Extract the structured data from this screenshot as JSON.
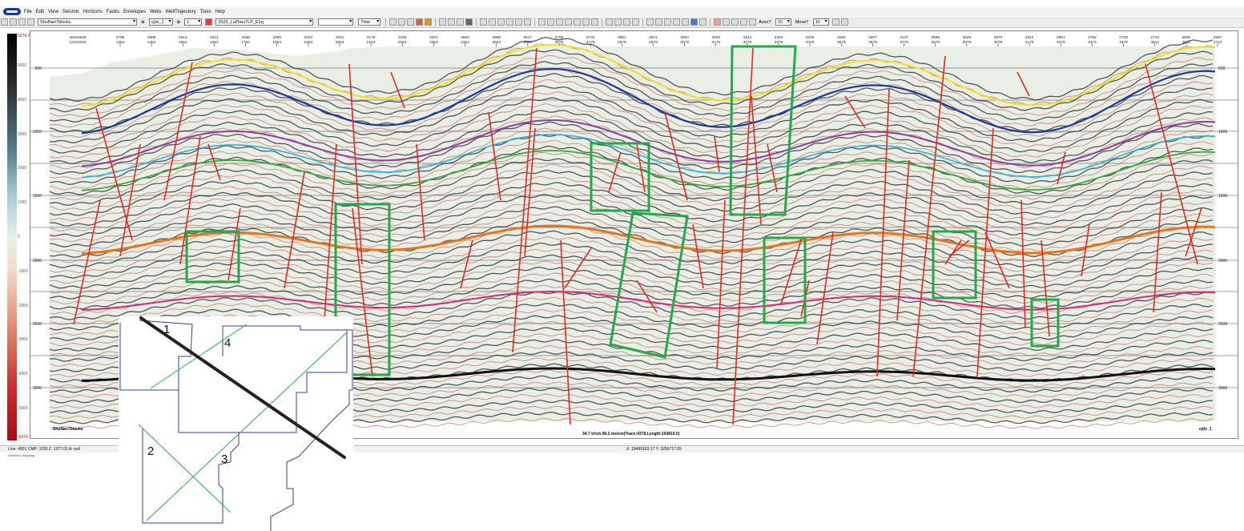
{
  "menu": [
    "File",
    "Edit",
    "View",
    "Seismic",
    "Horizons",
    "Faults",
    "Envelopes",
    "Wells",
    "WellTrajectory",
    "Tools",
    "Help"
  ],
  "toolbar": {
    "survey": "ShuNan7blocks",
    "line": "cjdx_1",
    "line_index": "1",
    "horizon": "2023_LuZhou7LP_E1q",
    "domain": "Time",
    "mode_value": "",
    "assoc_label": "AssoT",
    "assoc_value": "10",
    "move_label": "MoveT",
    "move_value": "10"
  },
  "colorbar": {
    "top_value": "6974.71",
    "bottom_value": "-6974.7",
    "labels": [
      "5000",
      "4000",
      "3000",
      "2000",
      "1000",
      "0",
      "-1000",
      "-2000",
      "-3000",
      "-4000",
      "-5000"
    ]
  },
  "axis": {
    "top_left_trace": "4845\n4830",
    "top_left_cmp": "1233\n1254",
    "ticks": [
      {
        "t": "4758",
        "c": "1354"
      },
      {
        "t": "4685",
        "c": "1454"
      },
      {
        "t": "4613",
        "c": "1554"
      },
      {
        "t": "4541",
        "c": "1654"
      },
      {
        "t": "4468",
        "c": "1754"
      },
      {
        "t": "4396",
        "c": "1854"
      },
      {
        "t": "4324",
        "c": "1954"
      },
      {
        "t": "4251",
        "c": "2054"
      },
      {
        "t": "4179",
        "c": "2154"
      },
      {
        "t": "4106",
        "c": "2254"
      },
      {
        "t": "4034",
        "c": "2354"
      },
      {
        "t": "3962",
        "c": "2454"
      },
      {
        "t": "3889",
        "c": "2554"
      },
      {
        "t": "3817",
        "c": "2654"
      },
      {
        "t": "3799",
        "c": "2679"
      },
      {
        "t": "3740",
        "c": "2779"
      },
      {
        "t": "3681",
        "c": "2879"
      },
      {
        "t": "3621",
        "c": "2979"
      },
      {
        "t": "3562",
        "c": "3079"
      },
      {
        "t": "3503",
        "c": "3179"
      },
      {
        "t": "3444",
        "c": "3279"
      },
      {
        "t": "3384",
        "c": "3379"
      },
      {
        "t": "3325",
        "c": "3479"
      },
      {
        "t": "3266",
        "c": "3579"
      },
      {
        "t": "3207",
        "c": "3679"
      },
      {
        "t": "3147",
        "c": "3779"
      },
      {
        "t": "3088",
        "c": "3879"
      },
      {
        "t": "3029",
        "c": "3979"
      },
      {
        "t": "2970",
        "c": "4079"
      },
      {
        "t": "2910",
        "c": "4179"
      },
      {
        "t": "2851",
        "c": "4279"
      },
      {
        "t": "2792",
        "c": "4379"
      },
      {
        "t": "2733",
        "c": "4479"
      },
      {
        "t": "2713",
        "c": "4512"
      },
      {
        "t": "2655",
        "c": "4612"
      },
      {
        "t": "2597",
        "c": "4712"
      }
    ],
    "time_labels": [
      "500",
      "1000",
      "1500",
      "2000",
      "2500",
      "3000"
    ]
  },
  "section": {
    "left_label": "ShuNan7blocks",
    "right_label": "cjdx_1",
    "scale_info": "34.7 tr/cm 96.2 ms/cm(Trace:4378,Length:103810.0)"
  },
  "status": {
    "left": "Line: 4901 CMP: 1155 Z: 1377.01 A: null",
    "right": "X: 18499163.17 Y: 3256717.05",
    "sub": "Directivo: ding/dog"
  },
  "inset_map": {
    "labels": [
      "1",
      "2",
      "3",
      "4"
    ]
  },
  "colors": {
    "fault": "#e8281e",
    "box": "#24a84a",
    "yellow": "#f2e225",
    "blue": "#1e3a9c",
    "purple": "#8c3fa0",
    "cyan": "#2ab4d6",
    "green": "#3aa83a",
    "orange": "#e8741e",
    "magenta": "#d42a7a",
    "black": "#111111"
  }
}
